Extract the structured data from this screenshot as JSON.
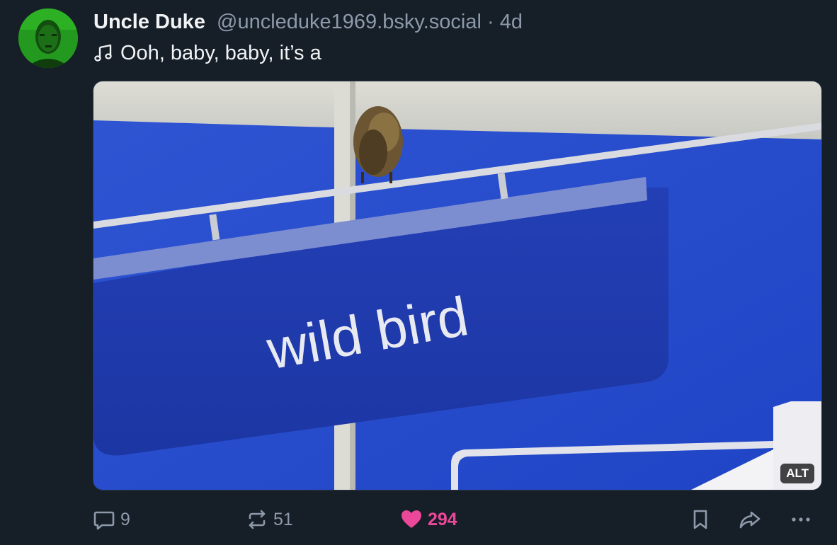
{
  "post": {
    "author": {
      "display_name": "Uncle Duke",
      "handle": "@uncleduke1969.bsky.social",
      "separator": "·",
      "age": "4d"
    },
    "text": "Ooh, baby, baby, it’s a",
    "text_icon": "music-note-icon",
    "media": {
      "sign_text": "wild bird",
      "alt_badge": "ALT"
    },
    "actions": {
      "reply": {
        "icon": "reply-bubble-icon",
        "count": "9"
      },
      "repost": {
        "icon": "repost-icon",
        "count": "51"
      },
      "like": {
        "icon": "heart-icon",
        "count": "294",
        "color": "#ec4899"
      },
      "save": {
        "icon": "bookmark-icon"
      },
      "share": {
        "icon": "share-arrow-icon"
      },
      "more": {
        "icon": "more-dots-icon"
      }
    }
  },
  "colors": {
    "background": "#161e27",
    "muted_text": "#8c9aab",
    "primary_text": "#f1f3f5",
    "like_accent": "#ec4899"
  }
}
